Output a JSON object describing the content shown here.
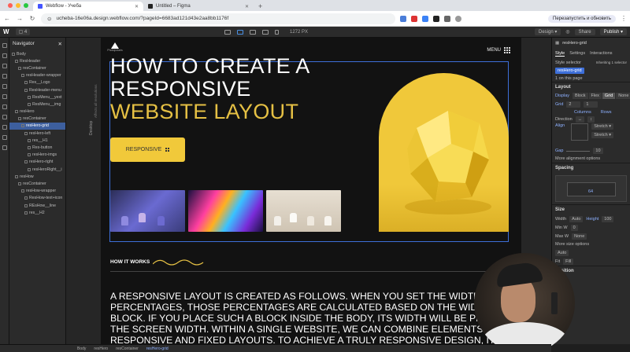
{
  "browser": {
    "tabs": [
      {
        "label": "Webflow - Учеба",
        "active": true,
        "favicon_color": "#4353ff"
      },
      {
        "label": "Untitled – Figma",
        "active": false,
        "favicon_color": "#222222"
      }
    ],
    "new_tab": "+",
    "url": "ucheba-16e06a.design.webflow.com/?pageId=6683ad121d43e2aa8bb1176f",
    "restart_label": "Перезапустить и обновить"
  },
  "webflow": {
    "logo": "W",
    "pages_label": "4",
    "canvas_width": "1272 PX",
    "mode": "Design",
    "share": "Share",
    "publish": "Publish"
  },
  "navigator": {
    "title": "Navigator",
    "items": [
      {
        "label": "Body",
        "indent": 0,
        "selected": false
      },
      {
        "label": "ResHeader",
        "indent": 1,
        "selected": false
      },
      {
        "label": "resContainer",
        "indent": 2,
        "selected": false
      },
      {
        "label": "resHeader-wrapper",
        "indent": 3,
        "selected": false
      },
      {
        "label": "Res__Logo",
        "indent": 4,
        "selected": false
      },
      {
        "label": "ResHeader-menu",
        "indent": 4,
        "selected": false
      },
      {
        "label": "ResMenu__yext",
        "indent": 5,
        "selected": false
      },
      {
        "label": "ResMenu__img",
        "indent": 5,
        "selected": false
      },
      {
        "label": "resHero",
        "indent": 1,
        "selected": false
      },
      {
        "label": "resContainer",
        "indent": 2,
        "selected": false
      },
      {
        "label": "resHero-grid",
        "indent": 3,
        "selected": true
      },
      {
        "label": "resHero-left",
        "indent": 4,
        "selected": false
      },
      {
        "label": "res__H1",
        "indent": 5,
        "selected": false
      },
      {
        "label": "Res-button",
        "indent": 5,
        "selected": false
      },
      {
        "label": "resHero-imgs",
        "indent": 5,
        "selected": false
      },
      {
        "label": "resHero-right",
        "indent": 4,
        "selected": false
      },
      {
        "label": "resHeroRight__i",
        "indent": 5,
        "selected": false
      },
      {
        "label": "resHow",
        "indent": 1,
        "selected": false
      },
      {
        "label": "resContainer",
        "indent": 2,
        "selected": false
      },
      {
        "label": "resHow-wrapper",
        "indent": 3,
        "selected": false
      },
      {
        "label": "ResHow-text+icon",
        "indent": 4,
        "selected": false
      },
      {
        "label": "REsHow__line",
        "indent": 4,
        "selected": false
      },
      {
        "label": "res__H2",
        "indent": 4,
        "selected": false
      }
    ]
  },
  "canvas": {
    "desktop_label": "Desktop",
    "affects_label": "Affects all resolutions",
    "logo_text": "Photopolaris",
    "menu_label": "MENU",
    "hero_line1": "HOW TO CREATE A",
    "hero_line2": "RESPONSIVE",
    "hero_line3": "WEBSITE LAYOUT",
    "button_label": "RESPONSIVE",
    "how_it_works": "HOW IT WORKS",
    "body_lines": [
      "A RESPONSIVE LAYOUT IS CREATED AS FOLLOWS. WHEN YOU SET THE WIDTH OF A BLOC",
      "PERCENTAGES, THOSE PERCENTAGES ARE CALCULATED BASED ON THE WIDTH OF THE",
      "BLOCK. IF YOU PLACE SUCH A BLOCK INSIDE THE BODY, ITS WIDTH WILL BE PROPORTIO",
      "THE SCREEN WIDTH. WITHIN A SINGLE WEBSITE, WE CAN COMBINE ELEMENTS OF BOTH",
      "RESPONSIVE AND FIXED LAYOUTS. TO ACHIEVE A TRULY RESPONSIVE DESIGN, IT IS ESSENTIAL"
    ],
    "accent_color": "#f0c83a"
  },
  "right_panel": {
    "element_name": "resHero-grid",
    "tabs": [
      "Style",
      "Settings",
      "Interactions"
    ],
    "style_selector_label": "Style selector",
    "inheriting": "Inheriting 1 selector",
    "class_chip": "resHero-grid",
    "on_page": "1 on this page",
    "layout_title": "Layout",
    "display_label": "Display",
    "display_options": [
      "Block",
      "Flex",
      "Grid",
      "None"
    ],
    "grid_label": "Grid",
    "grid_cols": "2",
    "grid_rows": "1",
    "columns_label": "Columns",
    "rows_label": "Rows",
    "direction_label": "Direction",
    "align_label": "Align",
    "stretch1": "Stretch",
    "stretch2": "Stretch",
    "gap_label": "Gap",
    "gap_value": "10",
    "more_alignment": "More alignment options",
    "spacing_title": "Spacing",
    "spacing_value": "64",
    "size_title": "Size",
    "width_label": "Width",
    "width_value": "Auto",
    "height_label": "Height",
    "height_value": "100",
    "min_w": "Min W",
    "max_w": "Max W",
    "more_size": "More size options",
    "fit_label": "Fit",
    "fit_value": "Fill",
    "auto_value": "Auto",
    "position_title": "Position"
  },
  "status_bar": {
    "crumbs": [
      "Body",
      "resHero",
      "resContainer",
      "resHero-grid"
    ]
  }
}
